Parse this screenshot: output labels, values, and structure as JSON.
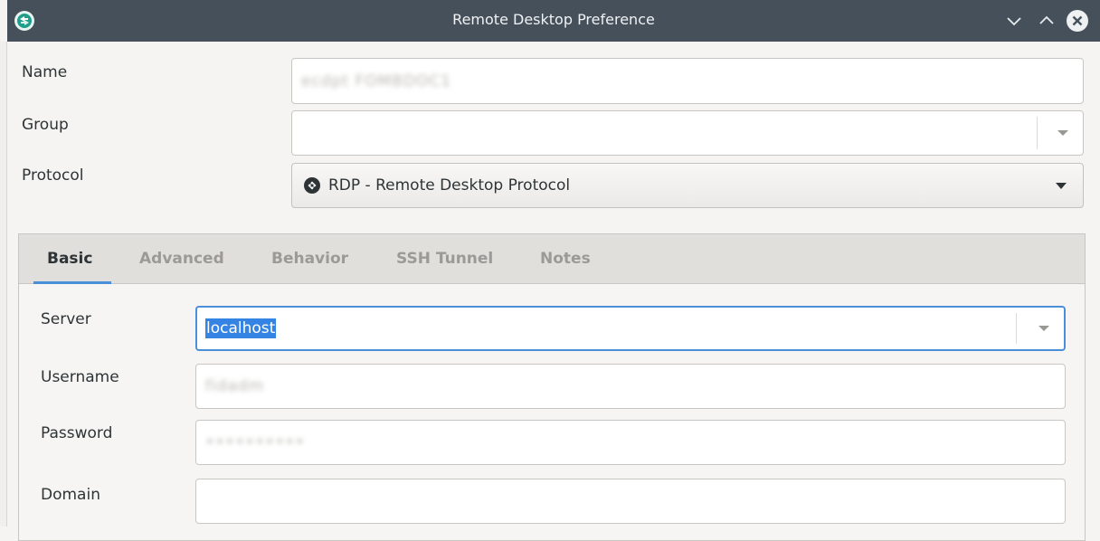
{
  "window": {
    "title": "Remote Desktop Preference",
    "controls": [
      "minimize",
      "maximize",
      "close"
    ]
  },
  "form": {
    "name_label": "Name",
    "name_value": "ecdpt FOMBDOC1",
    "group_label": "Group",
    "group_value": "",
    "protocol_label": "Protocol",
    "protocol_value": "RDP - Remote Desktop Protocol"
  },
  "tabs": [
    {
      "label": "Basic",
      "active": true
    },
    {
      "label": "Advanced",
      "active": false
    },
    {
      "label": "Behavior",
      "active": false
    },
    {
      "label": "SSH Tunnel",
      "active": false
    },
    {
      "label": "Notes",
      "active": false
    }
  ],
  "basic": {
    "server_label": "Server",
    "server_value": "localhost",
    "username_label": "Username",
    "username_value": "fidadm",
    "password_label": "Password",
    "password_value": "••••••••••",
    "domain_label": "Domain",
    "domain_value": ""
  },
  "colors": {
    "titlebar": "#45505b",
    "accent": "#4a90d9",
    "selection": "#3584e4"
  }
}
